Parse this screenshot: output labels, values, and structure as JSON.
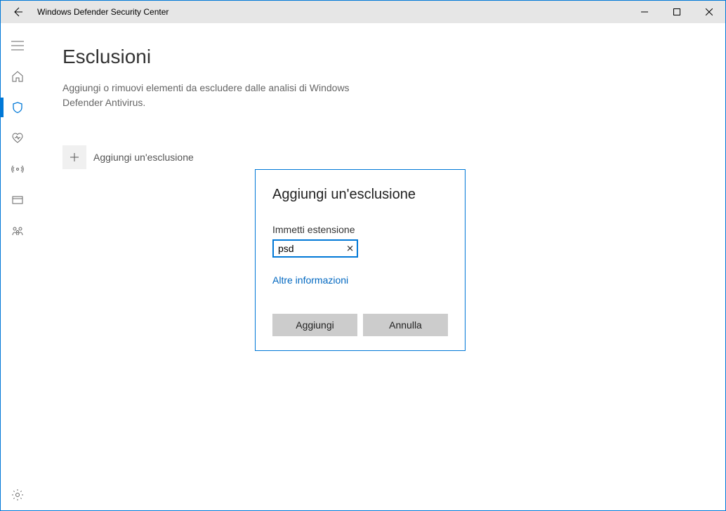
{
  "window": {
    "title": "Windows Defender Security Center"
  },
  "page": {
    "title": "Esclusioni",
    "description": "Aggiungi o rimuovi elementi da escludere dalle analisi di Windows Defender Antivirus.",
    "add_exclusion_label": "Aggiungi un'esclusione"
  },
  "dialog": {
    "title": "Aggiungi un'esclusione",
    "field_label": "Immetti estensione",
    "field_value": "psd",
    "more_info": "Altre informazioni",
    "add_button": "Aggiungi",
    "cancel_button": "Annulla"
  },
  "sidebar": {
    "items": [
      "menu",
      "home",
      "shield",
      "heart",
      "antenna",
      "network",
      "family"
    ],
    "active": "shield"
  }
}
